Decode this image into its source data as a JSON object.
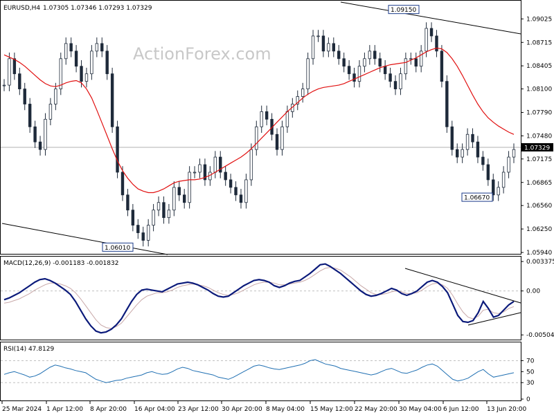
{
  "header": {
    "symbol": "EURUSD,H4",
    "ohlc": "1.07305 1.07346 1.07293 1.07329",
    "watermark": "ActionForex.com"
  },
  "colors": {
    "candles": "#1e2a3a",
    "ma": "#e11010",
    "macd": "#0b1a7a",
    "signal": "#c8a8a8",
    "rsi": "#1f6fb2",
    "grid": "#c0c0c0"
  },
  "chart_data": [
    {
      "type": "line",
      "title": "EURUSD,H4",
      "ylim": [
        1.0594,
        1.0922
      ],
      "price_ticks": [
        "1.09025",
        "1.08715",
        "1.08405",
        "1.08100",
        "1.07790",
        "1.07480",
        "1.07175",
        "1.06865",
        "1.06560",
        "1.06250",
        "1.05940"
      ],
      "current_price_label": "1.07329",
      "annotations": [
        {
          "text": "1.09150",
          "value": 1.0915
        },
        {
          "text": "1.06670",
          "value": 1.0667
        },
        {
          "text": "1.06010",
          "value": 1.0601
        }
      ],
      "x_ticks": [
        "25 Mar 2024",
        "1 Apr 12:00",
        "8 Apr 20:00",
        "16 Apr 04:00",
        "23 Apr 12:00",
        "30 Apr 20:00",
        "8 May 04:00",
        "15 May 12:00",
        "22 May 20:00",
        "30 May 04:00",
        "6 Jun 12:00",
        "13 Jun 20:00"
      ],
      "series": [
        {
          "values": [
            1.0815,
            1.085,
            1.083,
            1.081,
            1.079,
            1.076,
            1.074,
            1.073,
            1.077,
            1.079,
            1.081,
            1.085,
            1.087,
            1.086,
            1.084,
            1.082,
            1.083,
            1.086,
            1.087,
            1.086,
            1.083,
            1.076,
            1.07,
            1.067,
            1.065,
            1.063,
            1.062,
            1.061,
            1.063,
            1.065,
            1.066,
            1.064,
            1.065,
            1.068,
            1.067,
            1.066,
            1.07,
            1.07,
            1.071,
            1.069,
            1.07,
            1.072,
            1.07,
            1.069,
            1.068,
            1.067,
            1.066,
            1.069,
            1.073,
            1.076,
            1.078,
            1.077,
            1.075,
            1.073,
            1.076,
            1.078,
            1.079,
            1.08,
            1.081,
            1.085,
            1.088,
            1.088,
            1.086,
            1.087,
            1.086,
            1.085,
            1.084,
            1.083,
            1.082,
            1.084,
            1.085,
            1.086,
            1.085,
            1.084,
            1.083,
            1.082,
            1.081,
            1.083,
            1.085,
            1.085,
            1.084,
            1.086,
            1.089,
            1.088,
            1.086,
            1.082,
            1.076,
            1.073,
            1.072,
            1.073,
            1.075,
            1.074,
            1.072,
            1.071,
            1.069,
            1.067,
            1.068,
            1.07,
            1.072,
            1.073
          ]
        },
        {
          "values": [
            1.0855,
            1.0852,
            1.0849,
            1.0845,
            1.084,
            1.0834,
            1.0828,
            1.0822,
            1.0817,
            1.0814,
            1.0813,
            1.0815,
            1.0818,
            1.082,
            1.0821,
            1.0818,
            1.081,
            1.0798,
            1.0782,
            1.0765,
            1.0748,
            1.0731,
            1.0715,
            1.0702,
            1.0692,
            1.0684,
            1.0678,
            1.0675,
            1.0673,
            1.0673,
            1.0675,
            1.0678,
            1.0682,
            1.0686,
            1.0688,
            1.0689,
            1.069,
            1.069,
            1.0691,
            1.0693,
            1.0696,
            1.07,
            1.0704,
            1.0708,
            1.0712,
            1.0716,
            1.072,
            1.0725,
            1.0731,
            1.0738,
            1.0745,
            1.0752,
            1.0759,
            1.0766,
            1.0773,
            1.078,
            1.0786,
            1.0792,
            1.0798,
            1.0803,
            1.0807,
            1.081,
            1.0812,
            1.0813,
            1.0814,
            1.0815,
            1.0817,
            1.082,
            1.0823,
            1.0826,
            1.0829,
            1.0832,
            1.0835,
            1.0838,
            1.084,
            1.0842,
            1.0843,
            1.0844,
            1.0845,
            1.0848,
            1.0851,
            1.0855,
            1.0859,
            1.0862,
            1.0864,
            1.0863,
            1.0858,
            1.085,
            1.084,
            1.0828,
            1.0815,
            1.0802,
            1.079,
            1.078,
            1.0772,
            1.0766,
            1.0761,
            1.0757,
            1.0753,
            1.075
          ]
        }
      ]
    },
    {
      "type": "line",
      "title": "MACD(12,26,9) -0.001183 -0.001832",
      "ylim": [
        -0.0055,
        0.0037
      ],
      "y_ticks": [
        "0.003375",
        "0.00",
        "-0.00504"
      ],
      "series": [
        {
          "values": [
            -0.001,
            -0.0008,
            -0.0005,
            -0.0002,
            0.0002,
            0.0006,
            0.001,
            0.0013,
            0.0014,
            0.0012,
            0.0009,
            0.0005,
            0.0001,
            -0.0004,
            -0.0012,
            -0.0022,
            -0.0032,
            -0.004,
            -0.0046,
            -0.0048,
            -0.0047,
            -0.0044,
            -0.0039,
            -0.0032,
            -0.0022,
            -0.0012,
            -0.0004,
            0.0001,
            0.0002,
            0.0001,
            0.0,
            -0.0001,
            0.0002,
            0.0005,
            0.0008,
            0.0009,
            0.001,
            0.0009,
            0.0007,
            0.0004,
            0.0001,
            -0.0003,
            -0.0006,
            -0.0007,
            -0.0006,
            -0.0002,
            0.0002,
            0.0006,
            0.0009,
            0.0012,
            0.0013,
            0.0012,
            0.001,
            0.0006,
            0.0004,
            0.0006,
            0.0009,
            0.0011,
            0.0012,
            0.0016,
            0.002,
            0.0025,
            0.003,
            0.0031,
            0.0028,
            0.0024,
            0.002,
            0.0015,
            0.001,
            0.0005,
            0.0,
            -0.0004,
            -0.0006,
            -0.0005,
            -0.0003,
            0.0,
            0.0003,
            0.0001,
            -0.0003,
            -0.0005,
            -0.0003,
            0.0,
            0.0005,
            0.001,
            0.0012,
            0.001,
            0.0005,
            -0.0002,
            -0.0015,
            -0.0028,
            -0.0035,
            -0.0036,
            -0.0034,
            -0.0025,
            -0.0012,
            -0.002,
            -0.003,
            -0.0028,
            -0.0022,
            -0.0016,
            -0.0012
          ]
        },
        {
          "values": [
            -0.0014,
            -0.0013,
            -0.0011,
            -0.0009,
            -0.0006,
            -0.0003,
            0.0001,
            0.0004,
            0.0007,
            0.0009,
            0.0009,
            0.0008,
            0.0006,
            0.0003,
            -0.0002,
            -0.0009,
            -0.0017,
            -0.0025,
            -0.0033,
            -0.0039,
            -0.0042,
            -0.0043,
            -0.0041,
            -0.0037,
            -0.003,
            -0.0023,
            -0.0016,
            -0.001,
            -0.0006,
            -0.0004,
            -0.0002,
            -0.0002,
            -0.0001,
            0.0001,
            0.0004,
            0.0006,
            0.0007,
            0.0008,
            0.0007,
            0.0006,
            0.0004,
            0.0001,
            -0.0002,
            -0.0004,
            -0.0005,
            -0.0004,
            -0.0002,
            0.0001,
            0.0004,
            0.0007,
            0.0009,
            0.001,
            0.001,
            0.0009,
            0.0007,
            0.0007,
            0.0008,
            0.0009,
            0.001,
            0.0012,
            0.0015,
            0.0019,
            0.0023,
            0.0026,
            0.0027,
            0.0026,
            0.0024,
            0.002,
            0.0016,
            0.0011,
            0.0006,
            0.0002,
            -0.0002,
            -0.0004,
            -0.0004,
            -0.0003,
            -0.0001,
            0.0,
            -0.0001,
            -0.0003,
            -0.0003,
            -0.0002,
            0.0001,
            0.0005,
            0.0008,
            0.0009,
            0.0007,
            0.0003,
            -0.0005,
            -0.0015,
            -0.0024,
            -0.003,
            -0.0032,
            -0.0029,
            -0.0022,
            -0.0021,
            -0.0025,
            -0.0026,
            -0.0024,
            -0.002,
            -0.0018
          ]
        }
      ]
    },
    {
      "type": "line",
      "title": "RSI(14) 47.8129",
      "ylim": [
        0,
        100
      ],
      "y_ticks": [
        "70",
        "50",
        "30",
        "0"
      ],
      "series": [
        {
          "values": [
            45,
            48,
            50,
            47,
            44,
            40,
            42,
            46,
            52,
            58,
            62,
            60,
            57,
            55,
            52,
            50,
            48,
            42,
            36,
            33,
            30,
            32,
            34,
            35,
            38,
            40,
            42,
            44,
            48,
            50,
            47,
            45,
            46,
            50,
            55,
            58,
            56,
            52,
            50,
            48,
            46,
            44,
            40,
            38,
            36,
            40,
            45,
            50,
            55,
            60,
            62,
            60,
            57,
            55,
            54,
            56,
            58,
            60,
            62,
            65,
            70,
            72,
            68,
            64,
            62,
            60,
            56,
            54,
            52,
            50,
            48,
            46,
            44,
            46,
            50,
            54,
            56,
            52,
            48,
            47,
            50,
            53,
            58,
            62,
            64,
            60,
            52,
            44,
            36,
            33,
            35,
            38,
            44,
            50,
            54,
            46,
            40,
            42,
            44,
            46,
            48
          ]
        }
      ]
    }
  ]
}
